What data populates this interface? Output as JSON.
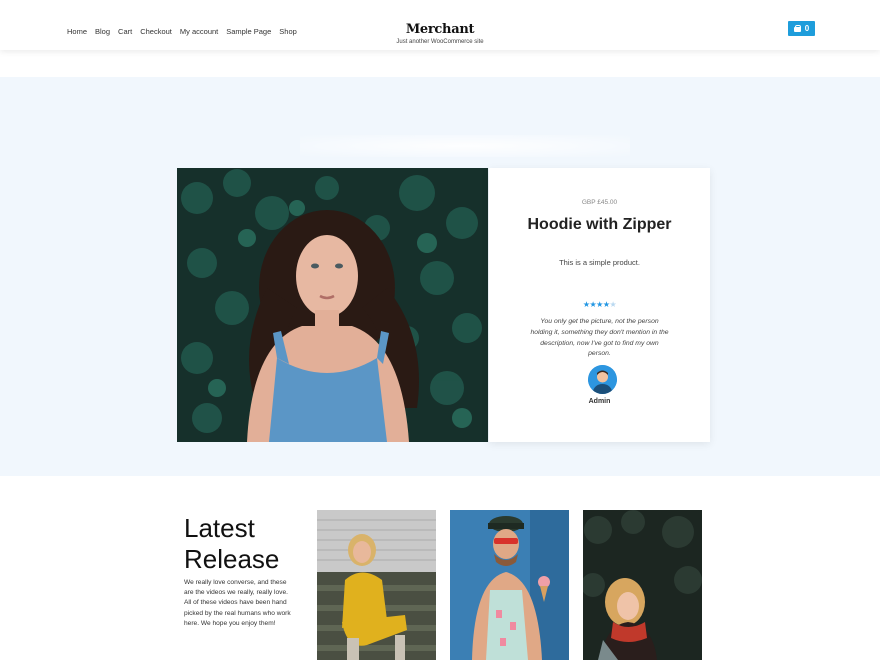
{
  "header": {
    "nav": [
      "Home",
      "Blog",
      "Cart",
      "Checkout",
      "My account",
      "Sample Page",
      "Shop"
    ],
    "brand_name": "Merchant",
    "tagline": "Just another WooCommerce site",
    "cart_count": "0",
    "cart_color": "#1e9ddb"
  },
  "hero": {
    "background": "#f1f7fd",
    "price": "GBP £45.00",
    "title": "Hoodie with Zipper",
    "description": "This is a simple product.",
    "rating": 4,
    "rating_max": 5,
    "review": "You only get the picture, not the person holding it, something they don't mention in the description, now I've got to find my own person.",
    "reviewer": "Admin"
  },
  "latest": {
    "title_line1": "Latest",
    "title_line2": "Release",
    "text": "We really love converse, and these are the videos we really, really love. All of these videos have been hand picked by the real humans who work here. We hope you enjoy them!"
  }
}
